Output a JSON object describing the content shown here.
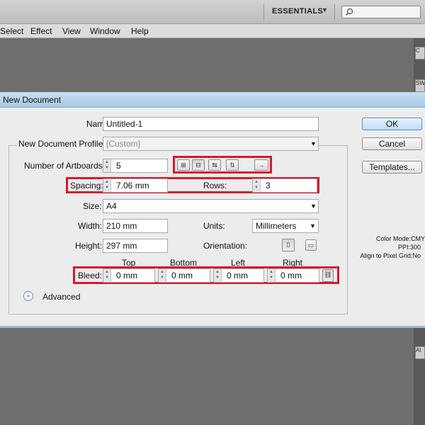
{
  "app": {
    "workspace": "ESSENTIALS",
    "menu": [
      "Select",
      "Effect",
      "View",
      "Window",
      "Help"
    ]
  },
  "dialog": {
    "title": "New Document",
    "name_label": "Name:",
    "name_value": "Untitled-1",
    "profile_label": "New Document Profile:",
    "profile_value": "[Custom]",
    "artboards_label": "Number of Artboards:",
    "artboards_value": "5",
    "spacing_label": "Spacing:",
    "spacing_value": "7.06 mm",
    "rows_label": "Rows:",
    "rows_value": "3",
    "size_label": "Size:",
    "size_value": "A4",
    "width_label": "Width:",
    "width_value": "210 mm",
    "units_label": "Units:",
    "units_value": "Millimeters",
    "height_label": "Height:",
    "height_value": "297 mm",
    "orientation_label": "Orientation:",
    "bleed_label": "Bleed:",
    "bleed_headers": [
      "Top",
      "Bottom",
      "Left",
      "Right"
    ],
    "bleed_values": [
      "0 mm",
      "0 mm",
      "0 mm",
      "0 mm"
    ],
    "advanced_label": "Advanced",
    "ok_label": "OK",
    "cancel_label": "Cancel",
    "templates_label": "Templates...",
    "info": {
      "color_mode": "Color Mode:CMY",
      "ppi": "PPI:300",
      "align": "Align to Pixel Grid:No"
    }
  },
  "panel_tabs": [
    "C",
    "SW",
    "Al"
  ],
  "icons": {
    "artboard_layout": [
      "grid-by-row-icon",
      "grid-by-column-icon",
      "arrange-by-row-icon",
      "arrange-by-column-icon",
      "right-to-left-icon"
    ],
    "accent": "#d8182d"
  }
}
